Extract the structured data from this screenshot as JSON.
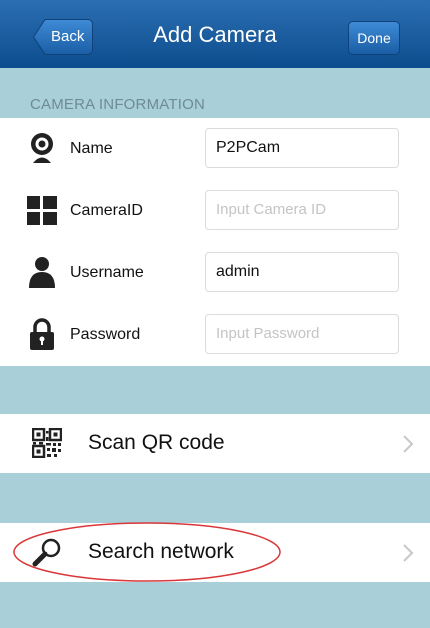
{
  "nav": {
    "back_label": "Back",
    "title": "Add Camera",
    "done_label": "Done"
  },
  "section": {
    "header": "CAMERA INFORMATION"
  },
  "fields": {
    "name": {
      "label": "Name",
      "value": "P2PCam",
      "placeholder": ""
    },
    "cameraid": {
      "label": "CameraID",
      "value": "",
      "placeholder": "Input Camera ID"
    },
    "username": {
      "label": "Username",
      "value": "admin",
      "placeholder": ""
    },
    "password": {
      "label": "Password",
      "value": "",
      "placeholder": "Input Password"
    }
  },
  "actions": {
    "scan_qr": "Scan QR code",
    "search_network": "Search network"
  },
  "icons": {
    "name": "webcam-icon",
    "cameraid": "grid-icon",
    "username": "user-icon",
    "password": "lock-icon",
    "scan_qr": "qr-code-icon",
    "search_network": "magnifier-icon"
  },
  "colors": {
    "nav_bar": "#1a5ea5",
    "background": "#a9cfd9",
    "highlight_ellipse": "#d9373a"
  }
}
